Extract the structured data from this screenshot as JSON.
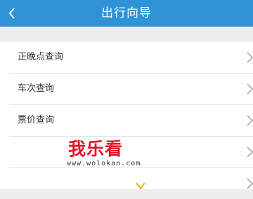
{
  "header": {
    "title": "出行向导",
    "back_icon": "chevron-left-icon",
    "background": "#2f93d8"
  },
  "menu": {
    "items": [
      {
        "label": "正晚点查询",
        "icon": "chevron-right-icon"
      },
      {
        "label": "车次查询",
        "icon": "chevron-right-icon"
      },
      {
        "label": "票价查询",
        "icon": "chevron-right-icon"
      },
      {
        "label": "",
        "icon": "chevron-right-icon"
      },
      {
        "label": "",
        "icon": "chevron-right-icon"
      }
    ]
  },
  "watermark": {
    "logo": "我乐看",
    "url": "www.wolokan.com",
    "color": "#e8122a"
  }
}
